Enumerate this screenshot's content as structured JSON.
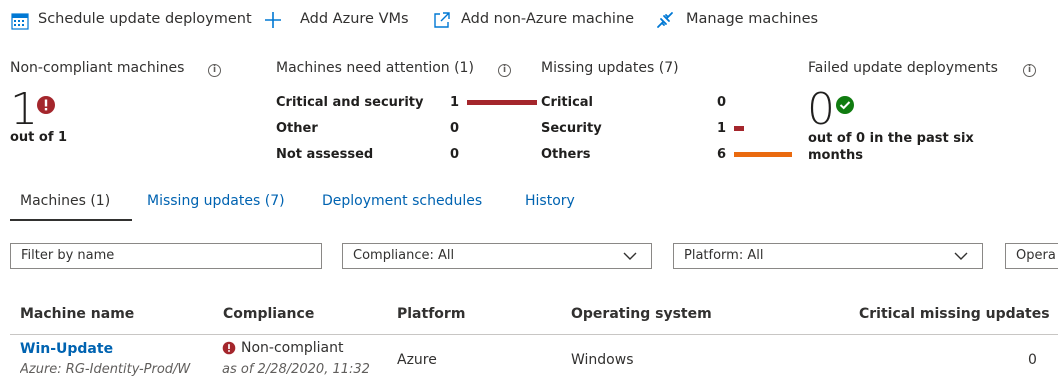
{
  "toolbar": {
    "schedule_label": "Schedule update deployment",
    "add_azure_label": "Add Azure VMs",
    "add_non_azure_label": "Add non-Azure machine",
    "manage_label": "Manage machines"
  },
  "summary": {
    "noncompliant": {
      "title": "Non-compliant machines",
      "count": "1",
      "subtext": "out of 1"
    },
    "attention": {
      "title": "Machines need attention (1)",
      "rows": [
        {
          "label": "Critical and security",
          "value": "1",
          "fraction": 1.0
        },
        {
          "label": "Other",
          "value": "0",
          "fraction": 0
        },
        {
          "label": "Not assessed",
          "value": "0",
          "fraction": 0
        }
      ]
    },
    "missing": {
      "title": "Missing updates (7)",
      "rows": [
        {
          "label": "Critical",
          "value": "0"
        },
        {
          "label": "Security",
          "value": "1"
        },
        {
          "label": "Others",
          "value": "6"
        }
      ]
    },
    "failed": {
      "title": "Failed update deployments",
      "count": "0",
      "subtext_line1": "out of 0 in the past six",
      "subtext_line2": "months"
    }
  },
  "tabs": [
    {
      "label": "Machines (1)"
    },
    {
      "label": "Missing updates (7)"
    },
    {
      "label": "Deployment schedules"
    },
    {
      "label": "History"
    }
  ],
  "filters": {
    "name_placeholder": "Filter by name",
    "compliance_label": "Compliance: All",
    "platform_label": "Platform: All",
    "os_label": "Opera"
  },
  "table": {
    "headers": {
      "machine": "Machine name",
      "compliance": "Compliance",
      "platform": "Platform",
      "os": "Operating system",
      "critical": "Critical missing updates"
    },
    "rows": [
      {
        "machine": "Win-Update",
        "machine_sub": "Azure: RG-Identity-Prod/W",
        "compliance": "Non-compliant",
        "compliance_sub": "as of 2/28/2020, 11:32",
        "platform": "Azure",
        "os": "Windows",
        "critical": "0"
      }
    ]
  },
  "colors": {
    "critical_bar": "#a4262c",
    "security_bar": "#a4262c",
    "others_bar": "#ea6a0f",
    "error": "#a4262c",
    "success": "#107c10",
    "link": "#0063b1",
    "accent": "#0078d4"
  }
}
